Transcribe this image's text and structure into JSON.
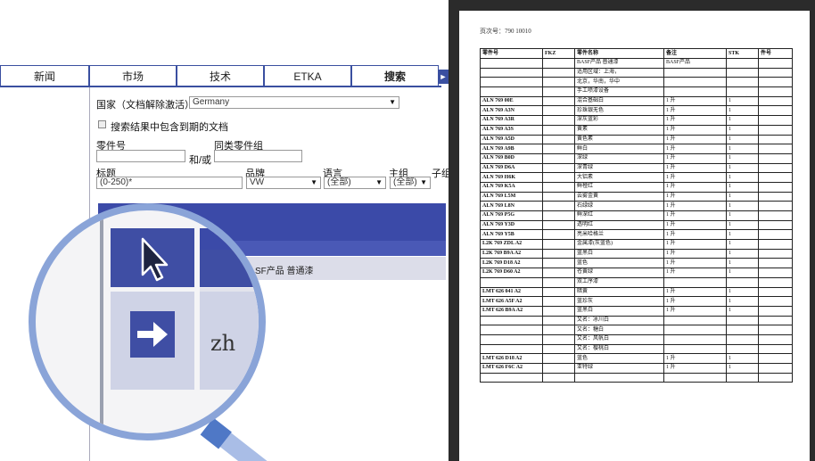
{
  "left": {
    "tabs": [
      {
        "label": "新闻",
        "active": false
      },
      {
        "label": "市场",
        "active": false
      },
      {
        "label": "技术",
        "active": false
      },
      {
        "label": "ETKA",
        "active": false
      },
      {
        "label": "搜索",
        "active": true
      }
    ],
    "country_label": "国家（文档解除激活）",
    "country_value": "Germany",
    "expired_checkbox_label": "搜索结果中包含到期的文档",
    "part_number_label": "零件号",
    "similar_group_label": "同类零件组",
    "and_or_label": "和/或",
    "title_label": "标题",
    "title_value": "(0-250)*",
    "brand_label": "品牌",
    "brand_value": "VW",
    "language_label": "语言",
    "language_value": "(全部)",
    "main_group_label": "主组",
    "main_group_value": "(全部)",
    "sub_group_label": "子组",
    "result_row_text": "SF产品 普通漆"
  },
  "magnifier": {
    "zh_label": "zh"
  },
  "document": {
    "title": "页次号：790 10010",
    "headers": [
      "零件号",
      "FKZ",
      "零件名称",
      "备注",
      "STK",
      "件号"
    ],
    "rows": [
      [
        "",
        "",
        "BASF产品 普通漆",
        "BASF产品",
        "",
        ""
      ],
      [
        "",
        "",
        "适用区域：上海，",
        "",
        "",
        ""
      ],
      [
        "",
        "",
        "北京，华南，华中",
        "",
        "",
        ""
      ],
      [
        "",
        "",
        "手工喷漆设备",
        "",
        "",
        ""
      ],
      [
        "ALN 769 00E",
        "",
        "混合基础白",
        "1 升",
        "1",
        ""
      ],
      [
        "ALN 769 A3N",
        "",
        "珍珠银无色",
        "1 升",
        "1",
        ""
      ],
      [
        "ALN 769 A3R",
        "",
        "深灰蓝彩",
        "1 升",
        "1",
        ""
      ],
      [
        "ALN 769 A3S",
        "",
        "黄素",
        "1 升",
        "1",
        ""
      ],
      [
        "ALN 769 A5D",
        "",
        "黄色素",
        "1 升",
        "1",
        ""
      ],
      [
        "ALN 769 A9B",
        "",
        "鲜白",
        "1 升",
        "1",
        ""
      ],
      [
        "ALN 769 B0D",
        "",
        "深绿",
        "1 升",
        "1",
        ""
      ],
      [
        "ALN 769 D6A",
        "",
        "深青绿",
        "1 升",
        "1",
        ""
      ],
      [
        "ALN 769 H6K",
        "",
        "大铝素",
        "1 升",
        "1",
        ""
      ],
      [
        "ALN 769 K5A",
        "",
        "鲜橙红",
        "1 升",
        "1",
        ""
      ],
      [
        "ALN 769 L5M",
        "",
        "云雾金黄",
        "1 升",
        "1",
        ""
      ],
      [
        "ALN 769 L8N",
        "",
        "石绿绿",
        "1 升",
        "1",
        ""
      ],
      [
        "ALN 769 P5G",
        "",
        "鲜深红",
        "1 升",
        "1",
        ""
      ],
      [
        "ALN 769 Y3D",
        "",
        "透明红",
        "1 升",
        "1",
        ""
      ],
      [
        "ALN 769 Y5B",
        "",
        "亮米哈格兰",
        "1 升",
        "1",
        ""
      ],
      [
        "L2K 769 ZDL A2",
        "",
        "金属漆(灰蓝色)",
        "1 升",
        "1",
        ""
      ],
      [
        "L2K 769 B9A A2",
        "",
        "蓝黑白",
        "1 升",
        "1",
        ""
      ],
      [
        "L2K 769 D18 A2",
        "",
        "蓝色",
        "1 升",
        "1",
        ""
      ],
      [
        "L2K 769 D60 A2",
        "",
        "苍黄绿",
        "1 升",
        "1",
        ""
      ],
      [
        "",
        "",
        "双工序漆",
        "",
        "",
        ""
      ],
      [
        "LMT 626 041 A2",
        "",
        "暗黄",
        "1 升",
        "1",
        ""
      ],
      [
        "LMT 626 A5F A2",
        "",
        "蓝珍灰",
        "1 升",
        "1",
        ""
      ],
      [
        "LMT 626 B9A A2",
        "",
        "蓝黑白",
        "1 升",
        "1",
        ""
      ],
      [
        "",
        "",
        "又名：冰川白",
        "",
        "",
        ""
      ],
      [
        "",
        "",
        "又名：糖白",
        "",
        "",
        ""
      ],
      [
        "",
        "",
        "又名：风帆白",
        "",
        "",
        ""
      ],
      [
        "",
        "",
        "又名：樱桃白",
        "",
        "",
        ""
      ],
      [
        "LMT 626 D18 A2",
        "",
        "蓝色",
        "1 升",
        "1",
        ""
      ],
      [
        "LMT 626 F6C A2",
        "",
        "亚特绿",
        "1 升",
        "1",
        ""
      ],
      [
        "",
        "",
        "",
        "",
        "",
        ""
      ]
    ]
  }
}
